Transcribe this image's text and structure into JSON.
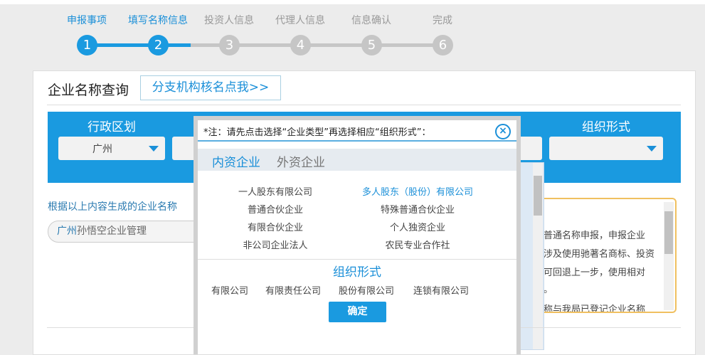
{
  "steps": [
    {
      "num": "1",
      "label": "申报事项",
      "active": true
    },
    {
      "num": "2",
      "label": "填写名称信息",
      "active": true
    },
    {
      "num": "3",
      "label": "投资人信息",
      "active": false
    },
    {
      "num": "4",
      "label": "代理人信息",
      "active": false
    },
    {
      "num": "5",
      "label": "信息确认",
      "active": false
    },
    {
      "num": "6",
      "label": "完成",
      "active": false
    }
  ],
  "page": {
    "title": "企业名称查询",
    "branch_button": "分支机构核名点我>>"
  },
  "filters": {
    "region_label": "行政区划",
    "region_value": "广州",
    "org_form_label": "组织形式"
  },
  "generated": {
    "label": "根据以上内容生成的企业名称",
    "value_prefix": "广州",
    "value_rest": "孙悟空企业管理"
  },
  "notice_lines": [
    "普通名称申报，申报企业",
    "涉及使用驰著名商标、投资",
    "可回退上一步，使用相对",
    "。",
    "称与我局已登记企业名称"
  ],
  "modal": {
    "note": "*注：请先点击选择“企业类型”再选择相应“组织形式”：",
    "tabs": [
      "内资企业",
      "外资企业"
    ],
    "types": [
      "一人股东有限公司",
      "多人股东（股份）有限公司",
      "普通合伙企业",
      "特殊普通合伙企业",
      "有限合伙企业",
      "个人独资企业",
      "非公司企业法人",
      "农民专业合作社"
    ],
    "org_title": "组织形式",
    "org_forms": [
      "有限公司",
      "有限责任公司",
      "股份有限公司",
      "连锁有限公司"
    ],
    "ok": "确定"
  },
  "colors": {
    "accent": "#1a9ae0",
    "warning_border": "#f0c060"
  }
}
